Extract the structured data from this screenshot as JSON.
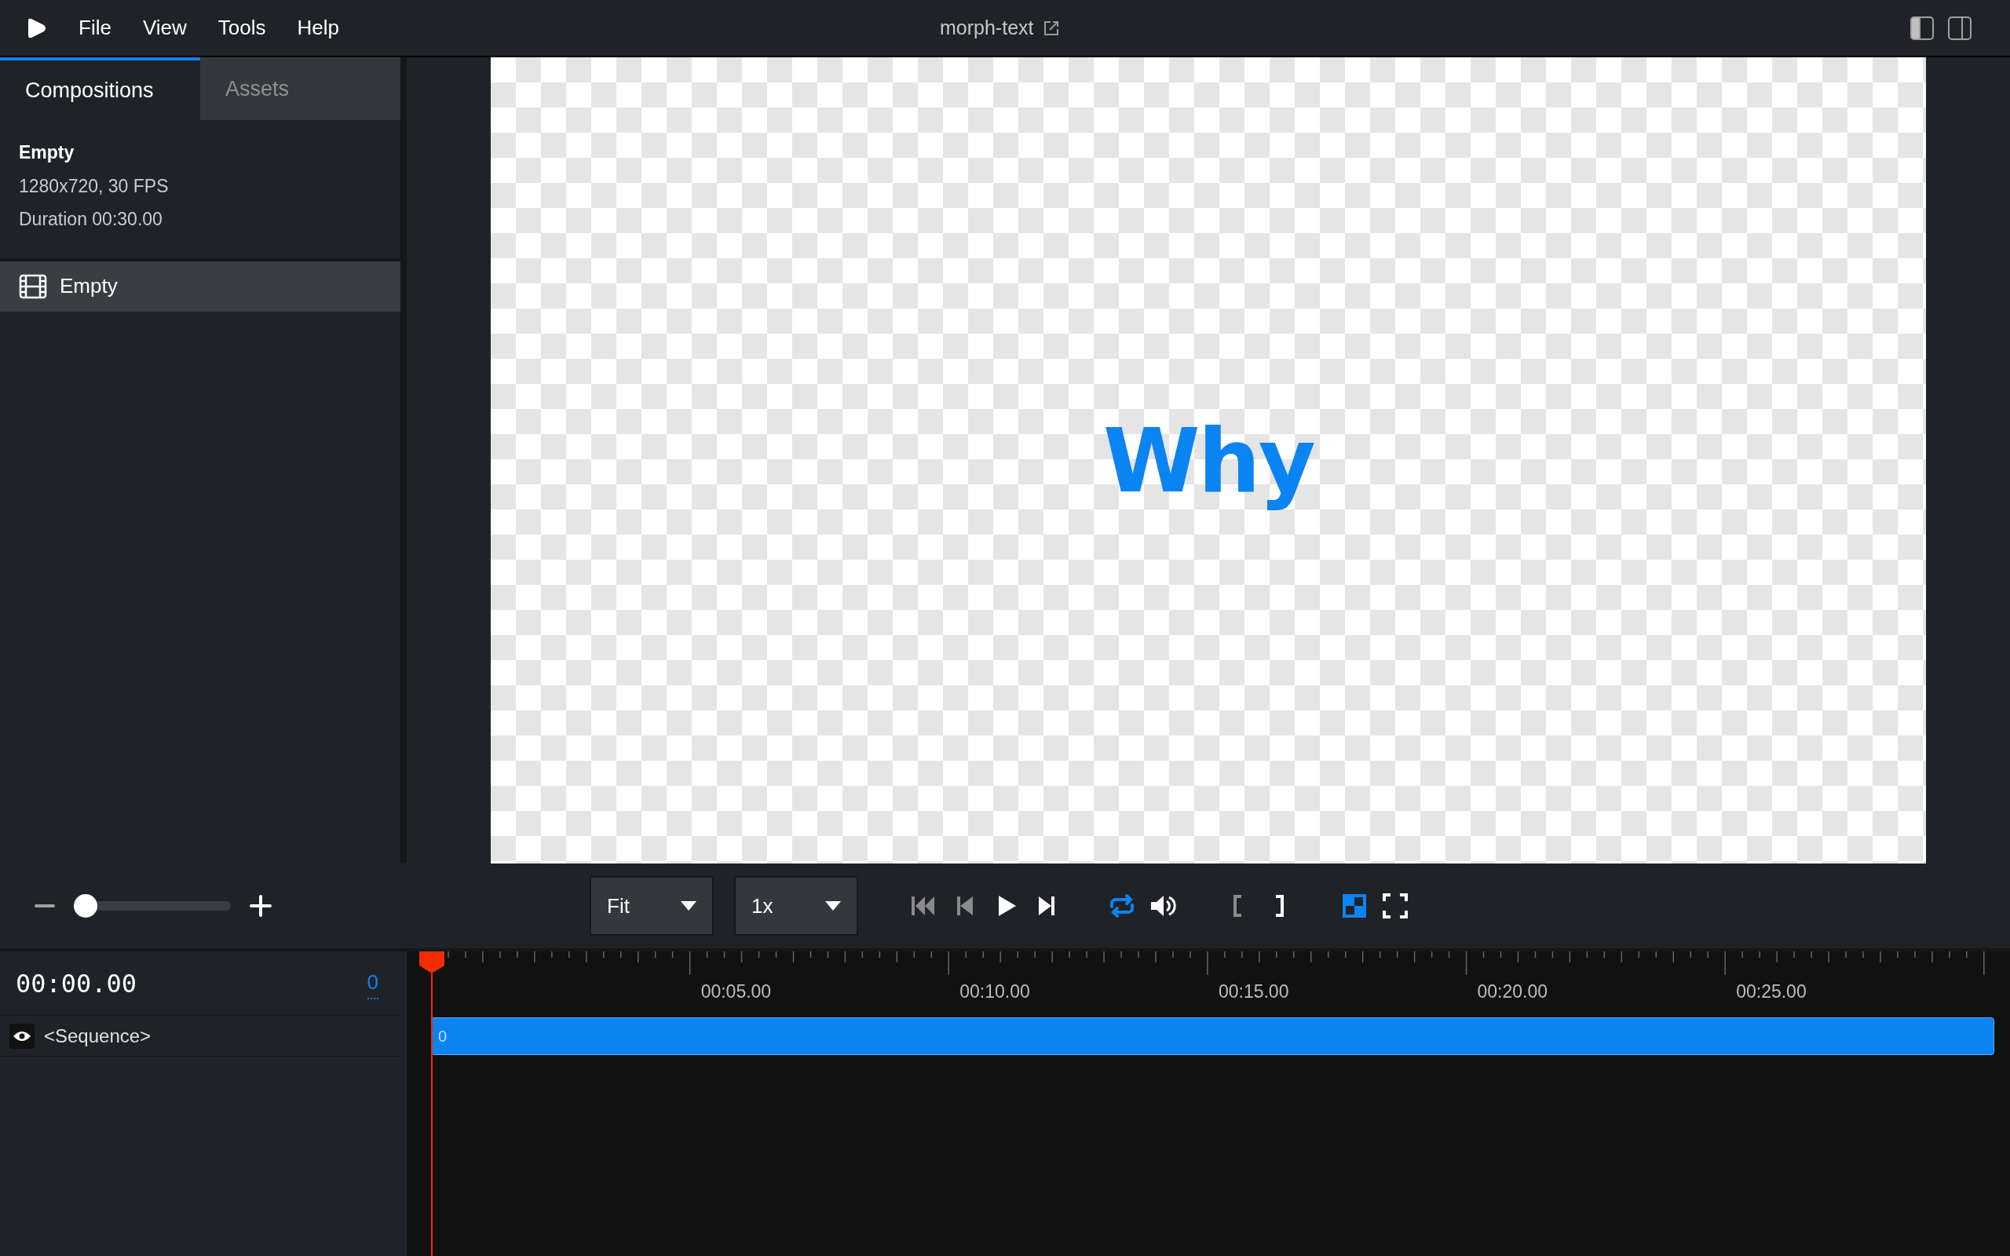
{
  "menu": [
    "File",
    "View",
    "Tools",
    "Help"
  ],
  "title": "morph-text",
  "panel_toggles": [
    {
      "kind": "left",
      "selected": true
    },
    {
      "kind": "right",
      "selected": false
    }
  ],
  "tabs": [
    {
      "label": "Compositions",
      "selected": true
    },
    {
      "label": "Assets",
      "selected": false
    }
  ],
  "composition": {
    "name": "Empty",
    "size": "1280x720, 30 FPS",
    "duration": "Duration 00:30.00"
  },
  "composition_list": [
    {
      "label": "Empty",
      "selected": true
    }
  ],
  "preview": {
    "text": "Why"
  },
  "zoom": {
    "level": 0
  },
  "size_dropdown": "Fit",
  "rate_dropdown": "1x",
  "transport": [
    {
      "kind": "jump-start",
      "disabled": true
    },
    {
      "kind": "prev-frame",
      "disabled": true
    },
    {
      "kind": "play",
      "disabled": false
    },
    {
      "kind": "next-frame",
      "disabled": false
    },
    {
      "kind": "loop",
      "active": true
    },
    {
      "kind": "volume",
      "active": false
    },
    {
      "kind": "in-mark",
      "disabled": true
    },
    {
      "kind": "out-mark",
      "disabled": false
    },
    {
      "kind": "checkerboard",
      "active": true
    },
    {
      "kind": "fullscreen",
      "active": false
    }
  ],
  "timeline": {
    "time": "00:00.00",
    "frame": "0",
    "ruler": [
      "00:05.00",
      "00:10.00",
      "00:15.00",
      "00:20.00",
      "00:25.00"
    ],
    "tracks": [
      {
        "label": "<Sequence>",
        "visible": true,
        "clip": "0"
      }
    ]
  }
}
